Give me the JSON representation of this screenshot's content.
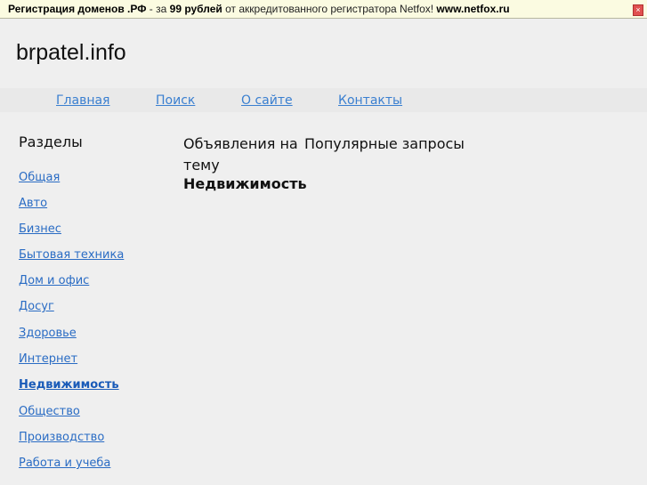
{
  "banner": {
    "part1": "Регистрация доменов .РФ",
    "part2": " - за ",
    "part3": "99 рублей",
    "part4": " от аккредитованного регистратора Netfox! ",
    "part5": "www.netfox.ru",
    "close": "×"
  },
  "site_title": "brpatel.info",
  "nav": [
    "Главная",
    "Поиск",
    "О сайте",
    "Контакты"
  ],
  "sidebar": {
    "heading": "Разделы",
    "items": [
      "Общая",
      "Авто",
      "Бизнес",
      "Бытовая техника",
      "Дом и офис",
      "Досуг",
      "Здоровье",
      "Интернет",
      "Недвижимость",
      "Общество",
      "Производство",
      "Работа и учеба"
    ]
  },
  "main": {
    "col1": "Объявления на тему",
    "col2": "Популярные запросы",
    "current": "Недвижимость"
  }
}
